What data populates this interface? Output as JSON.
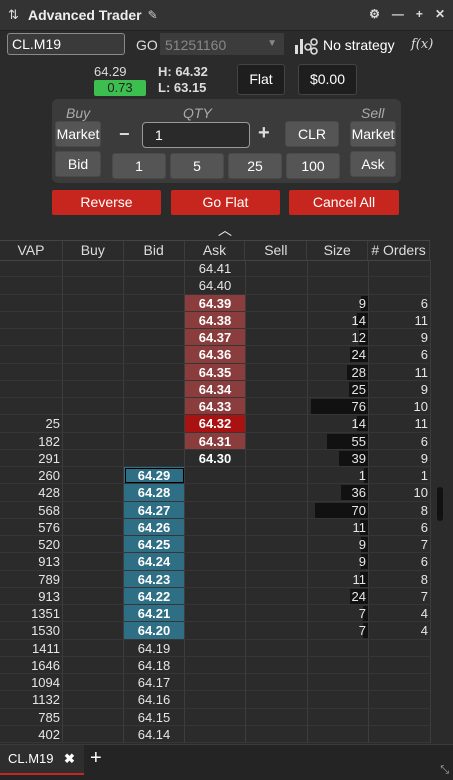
{
  "title": "Advanced Trader",
  "symbol": "CL.M19",
  "go_label": "GO",
  "account": "51251160",
  "strategy": "No strategy",
  "fx": "f(x)",
  "quote": {
    "last": "64.29",
    "change": "0.73",
    "high": "H: 64.32",
    "low": "L: 63.15"
  },
  "position": "Flat",
  "pnl": "$0.00",
  "panel": {
    "buy_label": "Buy",
    "qty_label": "QTY",
    "sell_label": "Sell",
    "buy_market": "Market",
    "buy_bid": "Bid",
    "minus": "−",
    "plus": "+",
    "qty_value": "1",
    "clr": "CLR",
    "sell_market": "Market",
    "sell_ask": "Ask",
    "presets": [
      "1",
      "5",
      "25",
      "100"
    ]
  },
  "actions": {
    "reverse": "Reverse",
    "go_flat": "Go Flat",
    "cancel_all": "Cancel All"
  },
  "columns": [
    "VAP",
    "Buy",
    "Bid",
    "Ask",
    "Sell",
    "Size",
    "# Orders"
  ],
  "ladder": [
    {
      "vap": "",
      "bid": "",
      "ask": "64.41",
      "size": "",
      "orders": "",
      "type": "ask-plain"
    },
    {
      "vap": "",
      "bid": "",
      "ask": "64.40",
      "size": "",
      "orders": "",
      "type": "ask-plain"
    },
    {
      "vap": "",
      "bid": "",
      "ask": "64.39",
      "size": "9",
      "orders": "6",
      "type": "ask"
    },
    {
      "vap": "",
      "bid": "",
      "ask": "64.38",
      "size": "14",
      "orders": "11",
      "type": "ask"
    },
    {
      "vap": "",
      "bid": "",
      "ask": "64.37",
      "size": "12",
      "orders": "9",
      "type": "ask"
    },
    {
      "vap": "",
      "bid": "",
      "ask": "64.36",
      "size": "24",
      "orders": "6",
      "type": "ask"
    },
    {
      "vap": "",
      "bid": "",
      "ask": "64.35",
      "size": "28",
      "orders": "11",
      "type": "ask"
    },
    {
      "vap": "",
      "bid": "",
      "ask": "64.34",
      "size": "25",
      "orders": "9",
      "type": "ask"
    },
    {
      "vap": "",
      "bid": "",
      "ask": "64.33",
      "size": "76",
      "orders": "10",
      "type": "ask"
    },
    {
      "vap": "25",
      "bid": "",
      "ask": "64.32",
      "size": "14",
      "orders": "11",
      "type": "ask-best"
    },
    {
      "vap": "182",
      "bid": "",
      "ask": "64.31",
      "size": "55",
      "orders": "6",
      "type": "ask"
    },
    {
      "vap": "291",
      "bid": "",
      "ask": "64.30",
      "size": "39",
      "orders": "9",
      "type": "ask-bold"
    },
    {
      "vap": "260",
      "bid": "64.29",
      "ask": "",
      "size": "1",
      "orders": "1",
      "type": "bid-best"
    },
    {
      "vap": "428",
      "bid": "64.28",
      "ask": "",
      "size": "36",
      "orders": "10",
      "type": "bid"
    },
    {
      "vap": "568",
      "bid": "64.27",
      "ask": "",
      "size": "70",
      "orders": "8",
      "type": "bid"
    },
    {
      "vap": "576",
      "bid": "64.26",
      "ask": "",
      "size": "11",
      "orders": "6",
      "type": "bid"
    },
    {
      "vap": "520",
      "bid": "64.25",
      "ask": "",
      "size": "9",
      "orders": "7",
      "type": "bid"
    },
    {
      "vap": "913",
      "bid": "64.24",
      "ask": "",
      "size": "9",
      "orders": "6",
      "type": "bid"
    },
    {
      "vap": "789",
      "bid": "64.23",
      "ask": "",
      "size": "11",
      "orders": "8",
      "type": "bid"
    },
    {
      "vap": "913",
      "bid": "64.22",
      "ask": "",
      "size": "24",
      "orders": "7",
      "type": "bid"
    },
    {
      "vap": "1351",
      "bid": "64.21",
      "ask": "",
      "size": "7",
      "orders": "4",
      "type": "bid"
    },
    {
      "vap": "1530",
      "bid": "64.20",
      "ask": "",
      "size": "7",
      "orders": "4",
      "type": "bid"
    },
    {
      "vap": "1411",
      "bid": "64.19",
      "ask": "",
      "size": "",
      "orders": "",
      "type": "bid-plain"
    },
    {
      "vap": "1646",
      "bid": "64.18",
      "ask": "",
      "size": "",
      "orders": "",
      "type": "bid-plain"
    },
    {
      "vap": "1094",
      "bid": "64.17",
      "ask": "",
      "size": "",
      "orders": "",
      "type": "bid-plain"
    },
    {
      "vap": "1132",
      "bid": "64.16",
      "ask": "",
      "size": "",
      "orders": "",
      "type": "bid-plain"
    },
    {
      "vap": "785",
      "bid": "64.15",
      "ask": "",
      "size": "",
      "orders": "",
      "type": "bid-plain"
    },
    {
      "vap": "402",
      "bid": "64.14",
      "ask": "",
      "size": "",
      "orders": "",
      "type": "bid-plain"
    }
  ],
  "tab_label": "CL.M19",
  "tab_close": "✖",
  "add_tab": "+"
}
